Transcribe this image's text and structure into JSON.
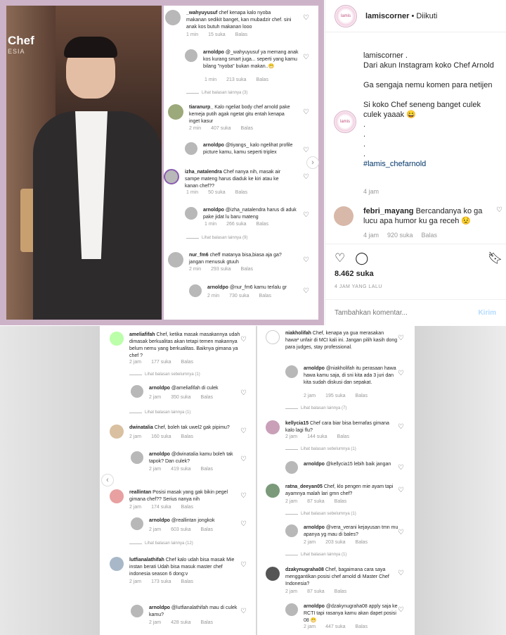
{
  "left_comments": [
    {
      "user": "_wahyuyusuf",
      "text": "chef kenapa kalo nyoba makanan sedikit banget, kan mubadzir chef. sini anak kos butuh makanan looo",
      "time": "1 min",
      "likes": "15 suka",
      "reply": "Balas"
    },
    {
      "user": "arnoldpo",
      "text": "@_wahyuyusuf ya memang anak kos kurang smart juga... seperti yang kamu bilang \"nyoba\" bukan makan..😁",
      "time": "1 min",
      "likes": "213 suka",
      "reply": "Balas"
    },
    {
      "user": "tiaranurp_",
      "text": "Kalo ngeliat body chef arnold pake kemeja putih agak ngetat gitu entah kenapa inget kasur",
      "time": "2 min",
      "likes": "407 suka",
      "reply": "Balas"
    },
    {
      "user": "arnoldpo",
      "text": "@tiyangs_ kalo ngelihat profile picture kamu, kamu seperti triplex",
      "time": "",
      "likes": "",
      "reply": ""
    },
    {
      "user": "izha_natalendra",
      "text": "Chef nanya nih, masak air sampe mateng harus diaduk ke kiri atau ke kanan chef??",
      "time": "1 min",
      "likes": "50 suka",
      "reply": "Balas"
    },
    {
      "user": "arnoldpo",
      "text": "@izha_natalendra harus di aduk pake jidat lu baru mateng",
      "time": "1 min",
      "likes": "266 suka",
      "reply": "Balas"
    },
    {
      "user": "nur_fm6",
      "text": "cheff matanya bisa,biasa aja ga? jangan menusuk gtuuh",
      "time": "2 min",
      "likes": "293 suka",
      "reply": "Balas"
    },
    {
      "user": "arnoldpo",
      "text": "@nur_fm6 kamu terlalu gr",
      "time": "2 min",
      "likes": "730 suka",
      "reply": "Balas"
    }
  ],
  "left_view_replies": [
    "Lihat balasan lainnya (3)",
    "Lihat balasan lainnya (9)"
  ],
  "brand": {
    "line1": "Chef",
    "line2": "ESIA"
  },
  "post": {
    "account": "lamiscorner",
    "follow": "• Diikuti",
    "logo_text": "lamis",
    "caption": [
      "lamiscorner .",
      "Dari akun Instagram koko Chef Arnold",
      "",
      "Ga sengaja nemu komen para netijen",
      "",
      "Si koko Chef seneng banget culek culek yaaak 😄",
      ".",
      ".",
      ".",
      "."
    ],
    "hashtag": "#lamis_chefarnold",
    "time": "4 jam",
    "comment": {
      "user": "febri_mayang",
      "text": "Bercandanya ko ga lucu apa humor ku ga receh 😟",
      "time": "4 jam",
      "likes": "920 suka",
      "reply": "Balas"
    },
    "likes": "8.462 suka",
    "date": "4 JAM YANG LALU",
    "add_placeholder": "Tambahkan komentar...",
    "post_button": "Kirim"
  },
  "bottom_left": [
    {
      "user": "ameliafifah",
      "text": "Chef, ketika masak masakannya udah dimasak berkualitas akan tetapi temen makannya belum nemu yang berkualitas. Baiknya gimana ya chef ?",
      "time": "2 jam",
      "likes": "177 suka",
      "reply": "Balas"
    },
    {
      "user": "arnoldpo",
      "text": "@ameliafifah di culek",
      "time": "2 jam",
      "likes": "350 suka",
      "reply": "Balas"
    },
    {
      "user": "dwinatalia",
      "text": "Chef, boleh tak uwel2 gak pipimu?",
      "time": "2 jam",
      "likes": "160 suka",
      "reply": "Balas"
    },
    {
      "user": "arnoldpo",
      "text": "@dwinatalia kamu boleh tak tapok? Dan culek?",
      "time": "2 jam",
      "likes": "419 suka",
      "reply": "Balas"
    },
    {
      "user": "reallintan",
      "text": "Posisi masak yang gak bikin pegel gimana chef?? Serius nanya nih",
      "time": "2 jam",
      "likes": "174 suka",
      "reply": "Balas"
    },
    {
      "user": "arnoldpo",
      "text": "@reallintan jongkok",
      "time": "2 jam",
      "likes": "603 suka",
      "reply": "Balas"
    },
    {
      "user": "lutfianalathifah",
      "text": "Chef kalo udah bisa masak Mie instan berati Udah bisa masuk master chef indonesia season 6 dong:v",
      "time": "2 jam",
      "likes": "173 suka",
      "reply": "Balas"
    },
    {
      "user": "arnoldpo",
      "text": "@lutfianalathifah mau di culek kamu?",
      "time": "2 jam",
      "likes": "428 suka",
      "reply": "Balas"
    }
  ],
  "bottom_left_view": [
    "Lihat balasan sebelumnya (1)",
    "Lihat balasan lainnya (1)",
    "Lihat balasan sebelumnya (1)",
    "Lihat balasan lainnya (12)"
  ],
  "bottom_right": [
    {
      "user": "niakholifah",
      "text": "Chef, kenapa ya gua merasakan hawa² unfair di MCI kali ini. Jangan pilih kasih dong para judges, stay professional.",
      "time": "",
      "likes": "",
      "reply": ""
    },
    {
      "user": "arnoldpo",
      "text": "@niakholifah itu perasaan hawa hawa kamu saja, di sni kita ada 3 juri dan kita sudah diskusi dan sepakat.",
      "time": "2 jam",
      "likes": "195 suka",
      "reply": "Balas"
    },
    {
      "user": "kellycia15",
      "text": "Chef cara biar bisa bernafas gimana kalo lagi flu?",
      "time": "2 jam",
      "likes": "144 suka",
      "reply": "Balas"
    },
    {
      "user": "arnoldpo",
      "text": "@kellycia15 lebih baik jangan",
      "time": "",
      "likes": "",
      "reply": ""
    },
    {
      "user": "ratna_deeyan05",
      "text": "Chef, klo pengen mie ayam tapi ayamnya malah lari gmn chef?",
      "time": "2 jam",
      "likes": "87 suka",
      "reply": "Balas"
    },
    {
      "user": "arnoldpo",
      "text": "@vera_verani kejayusan tmn mu apanya yg mau di bales?",
      "time": "2 jam",
      "likes": "203 suka",
      "reply": "Balas"
    },
    {
      "user": "dzakynugraha08",
      "text": "Chef, bagaimana cara saya menggantikan posisi chef arnold di Master Chef Indonesia?",
      "time": "2 jam",
      "likes": "87 suka",
      "reply": "Balas"
    },
    {
      "user": "arnoldpo",
      "text": "@dzakynugraha08 apply saja ke RCTI tapi rasanya kamu akan dapet posisi 08 😁",
      "time": "2 jam",
      "likes": "447 suka",
      "reply": "Balas"
    }
  ],
  "bottom_right_view": [
    "Lihat balasan lainnya (7)",
    "Lihat balasan sebelumnya (1)",
    "Lihat balasan sebelumnya (1)",
    "Lihat balasan lainnya (1)"
  ]
}
